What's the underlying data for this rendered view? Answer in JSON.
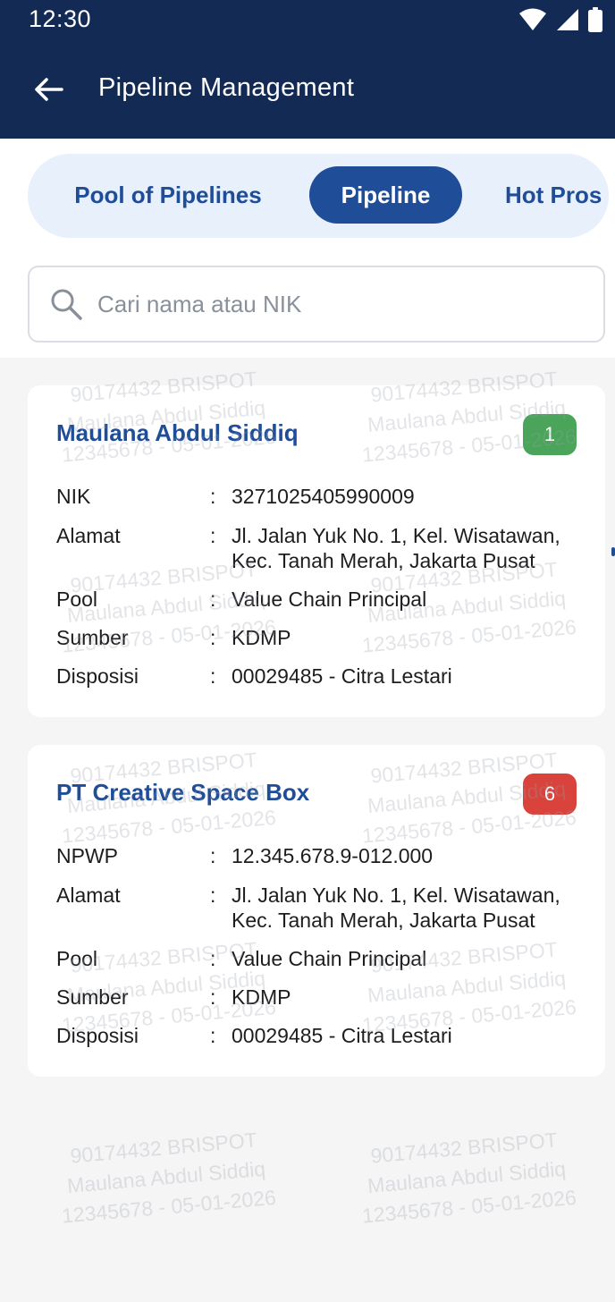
{
  "status_bar": {
    "time": "12:30",
    "icons": [
      "wifi-icon",
      "cell-signal-icon",
      "battery-icon"
    ]
  },
  "header": {
    "title": "Pipeline Management",
    "back_icon": "arrow-left-icon"
  },
  "tabs": [
    {
      "label": "Pool of Pipelines",
      "active": false
    },
    {
      "label": "Pipeline",
      "active": true
    },
    {
      "label": "Hot Pros",
      "active": false
    }
  ],
  "search": {
    "placeholder": "Cari nama atau NIK",
    "value": ""
  },
  "watermark": {
    "line1": "90174432 BRISPOT",
    "line2": "Maulana Abdul Siddiq",
    "line3": "12345678 - 05-01-2026"
  },
  "cards": [
    {
      "name": "Maulana Abdul Siddiq",
      "badge": "1",
      "badge_color": "#4aa55a",
      "fields": [
        {
          "label": "NIK",
          "sep": ":",
          "value": "3271025405990009"
        },
        {
          "label": "Alamat",
          "sep": ":",
          "value": "Jl. Jalan Yuk No. 1, Kel. Wisatawan, Kec. Tanah Merah, Jakarta Pusat"
        },
        {
          "label": "Pool",
          "sep": ":",
          "value": "Value Chain Principal"
        },
        {
          "label": "Sumber",
          "sep": ":",
          "value": "KDMP"
        },
        {
          "label": "Disposisi",
          "sep": ":",
          "value": "00029485 - Citra Lestari"
        }
      ]
    },
    {
      "name": "PT Creative Space Box",
      "badge": "6",
      "badge_color": "#d9433c",
      "fields": [
        {
          "label": "NPWP",
          "sep": ":",
          "value": "12.345.678.9-012.000"
        },
        {
          "label": "Alamat",
          "sep": ":",
          "value": "Jl. Jalan Yuk No. 1, Kel. Wisatawan, Kec. Tanah Merah, Jakarta Pusat"
        },
        {
          "label": "Pool",
          "sep": ":",
          "value": "Value Chain Principal"
        },
        {
          "label": "Sumber",
          "sep": ":",
          "value": "KDMP"
        },
        {
          "label": "Disposisi",
          "sep": ":",
          "value": "00029485 - Citra Lestari"
        }
      ]
    }
  ],
  "colors": {
    "header_bg": "#132b54",
    "accent": "#1f4d98",
    "tab_bg": "#e8f0fb",
    "page_bg": "#f5f5f6"
  }
}
